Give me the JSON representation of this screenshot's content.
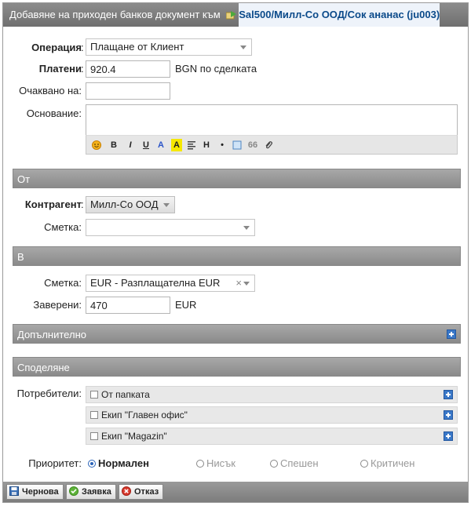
{
  "title": {
    "prefix": "Добавяне на приходен банков документ към",
    "link": "Sal500/Милл-Со ООД/Сок ананас (ju003)",
    "link_icon": "folder-arrow-icon"
  },
  "form": {
    "operation": {
      "label": "Операция",
      "value": "Плащане от Клиент"
    },
    "paid": {
      "label": "Платени",
      "value": "920.4",
      "suffix": "BGN по сделката"
    },
    "expected": {
      "label": "Очаквано на:",
      "value": ""
    },
    "reason": {
      "label": "Основание:",
      "value": ""
    }
  },
  "editor_tools": [
    "smile-icon",
    "B",
    "I",
    "U",
    "A",
    "A",
    "align-icon",
    "H",
    "•",
    "box-icon",
    "66",
    "paperclip-icon"
  ],
  "sections": {
    "from": {
      "title": "От"
    },
    "to": {
      "title": "В"
    },
    "extra": {
      "title": "Допълнително"
    },
    "share": {
      "title": "Споделяне"
    }
  },
  "from": {
    "contragent": {
      "label": "Контрагент",
      "value": "Милл-Со ООД"
    },
    "account": {
      "label": "Сметка:",
      "value": ""
    }
  },
  "to": {
    "account": {
      "label": "Сметка:",
      "value": "EUR - Разплащателна EUR",
      "clear": "×"
    },
    "certified": {
      "label": "Заверени:",
      "value": "470",
      "suffix": "EUR"
    }
  },
  "share": {
    "users_label": "Потребители:",
    "groups": [
      {
        "label": "От папката"
      },
      {
        "label": "Екип \"Главен офис\""
      },
      {
        "label": "Екип \"Magazin\""
      }
    ]
  },
  "priority": {
    "label": "Приоритет:",
    "options": [
      "Нормален",
      "Нисък",
      "Спешен",
      "Критичен"
    ],
    "selected": "Нормален"
  },
  "footer": {
    "draft": "Чернова",
    "submit": "Заявка",
    "cancel": "Отказ"
  },
  "colors": {
    "accent": "#0b4a8a",
    "header": "#7a7a7a",
    "radio": "#2b63b8"
  }
}
